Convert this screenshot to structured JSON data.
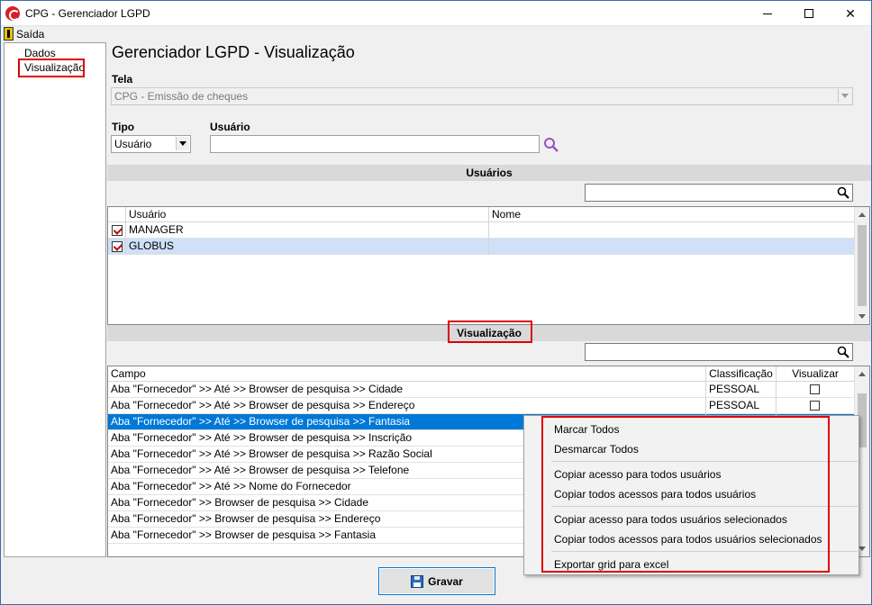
{
  "window": {
    "title": "CPG - Gerenciador LGPD"
  },
  "menu": {
    "exit_label": "Saída"
  },
  "tree": {
    "items": [
      "Dados",
      "Visualização"
    ]
  },
  "page": {
    "title": "Gerenciador LGPD - Visualização"
  },
  "form": {
    "tela_label": "Tela",
    "tela_value": "CPG - Emissão de cheques",
    "tipo_label": "Tipo",
    "tipo_value": "Usuário",
    "usuario_label": "Usuário",
    "usuario_value": ""
  },
  "users_section": {
    "title": "Usuários",
    "search_value": "",
    "columns": [
      "Usuário",
      "Nome"
    ],
    "rows": [
      {
        "checked": true,
        "usuario": "MANAGER",
        "nome": ""
      },
      {
        "checked": true,
        "usuario": "GLOBUS",
        "nome": ""
      }
    ]
  },
  "vis_section": {
    "title": "Visualização",
    "search_value": "",
    "columns": [
      "Campo",
      "Classificação",
      "Visualizar"
    ],
    "rows": [
      {
        "campo": "Aba \"Fornecedor\" >> Até >> Browser de pesquisa >> Cidade",
        "classificacao": "PESSOAL",
        "visualizar": false
      },
      {
        "campo": "Aba \"Fornecedor\" >> Até >> Browser de pesquisa >> Endereço",
        "classificacao": "PESSOAL",
        "visualizar": false
      },
      {
        "campo": "Aba \"Fornecedor\" >> Até >> Browser de pesquisa >> Fantasia",
        "classificacao": "",
        "visualizar": false
      },
      {
        "campo": "Aba \"Fornecedor\" >> Até >> Browser de pesquisa >> Inscrição",
        "classificacao": "",
        "visualizar": false
      },
      {
        "campo": "Aba \"Fornecedor\" >> Até >> Browser de pesquisa >> Razão Social",
        "classificacao": "",
        "visualizar": false
      },
      {
        "campo": "Aba \"Fornecedor\" >> Até >> Browser de pesquisa >> Telefone",
        "classificacao": "",
        "visualizar": false
      },
      {
        "campo": "Aba \"Fornecedor\" >> Até >> Nome do Fornecedor",
        "classificacao": "",
        "visualizar": false
      },
      {
        "campo": "Aba \"Fornecedor\" >> Browser de pesquisa >> Cidade",
        "classificacao": "",
        "visualizar": false
      },
      {
        "campo": "Aba \"Fornecedor\" >> Browser de pesquisa >> Endereço",
        "classificacao": "",
        "visualizar": false
      },
      {
        "campo": "Aba \"Fornecedor\" >> Browser de pesquisa >> Fantasia",
        "classificacao": "",
        "visualizar": false
      }
    ]
  },
  "context_menu": {
    "items": [
      "Marcar Todos",
      "Desmarcar Todos",
      "Copiar acesso para todos usuários",
      "Copiar todos acessos para todos usuários",
      "Copiar acesso para todos usuários selecionados",
      "Copiar todos acessos para todos usuários selecionados",
      "Exportar grid para excel"
    ]
  },
  "buttons": {
    "save_label": "Gravar"
  },
  "colors": {
    "highlight_red": "#e00000",
    "selection_blue": "#0078d7",
    "brand_red": "#d4202a"
  }
}
